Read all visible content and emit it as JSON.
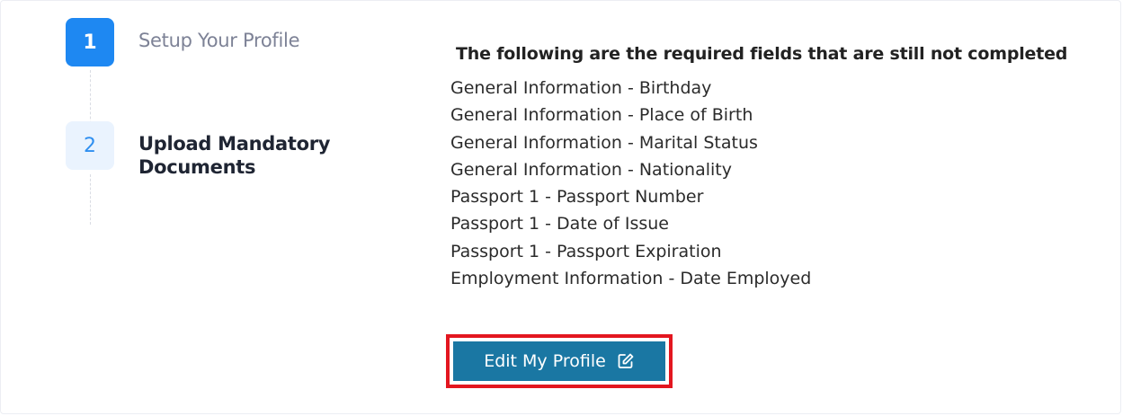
{
  "stepper": {
    "steps": [
      {
        "number": "1",
        "label": "Setup Your Profile",
        "state": "active"
      },
      {
        "number": "2",
        "label": "Upload Mandatory Documents",
        "state": "inactive"
      }
    ]
  },
  "main": {
    "heading": "The following are the required fields that are still not completed",
    "fields": [
      "General Information - Birthday",
      "General Information - Place of Birth",
      "General Information - Marital Status",
      "General Information - Nationality",
      "Passport 1 - Passport Number",
      "Passport 1 - Date of Issue",
      "Passport 1 - Passport Expiration",
      "Employment Information - Date Employed"
    ],
    "edit_button": {
      "label": "Edit My Profile",
      "icon": "edit-icon"
    }
  },
  "colors": {
    "step_active": "#1e88f2",
    "step_inactive_bg": "#eaf3fe",
    "button_bg": "#1a77a3",
    "highlight_border": "#e3161f"
  }
}
